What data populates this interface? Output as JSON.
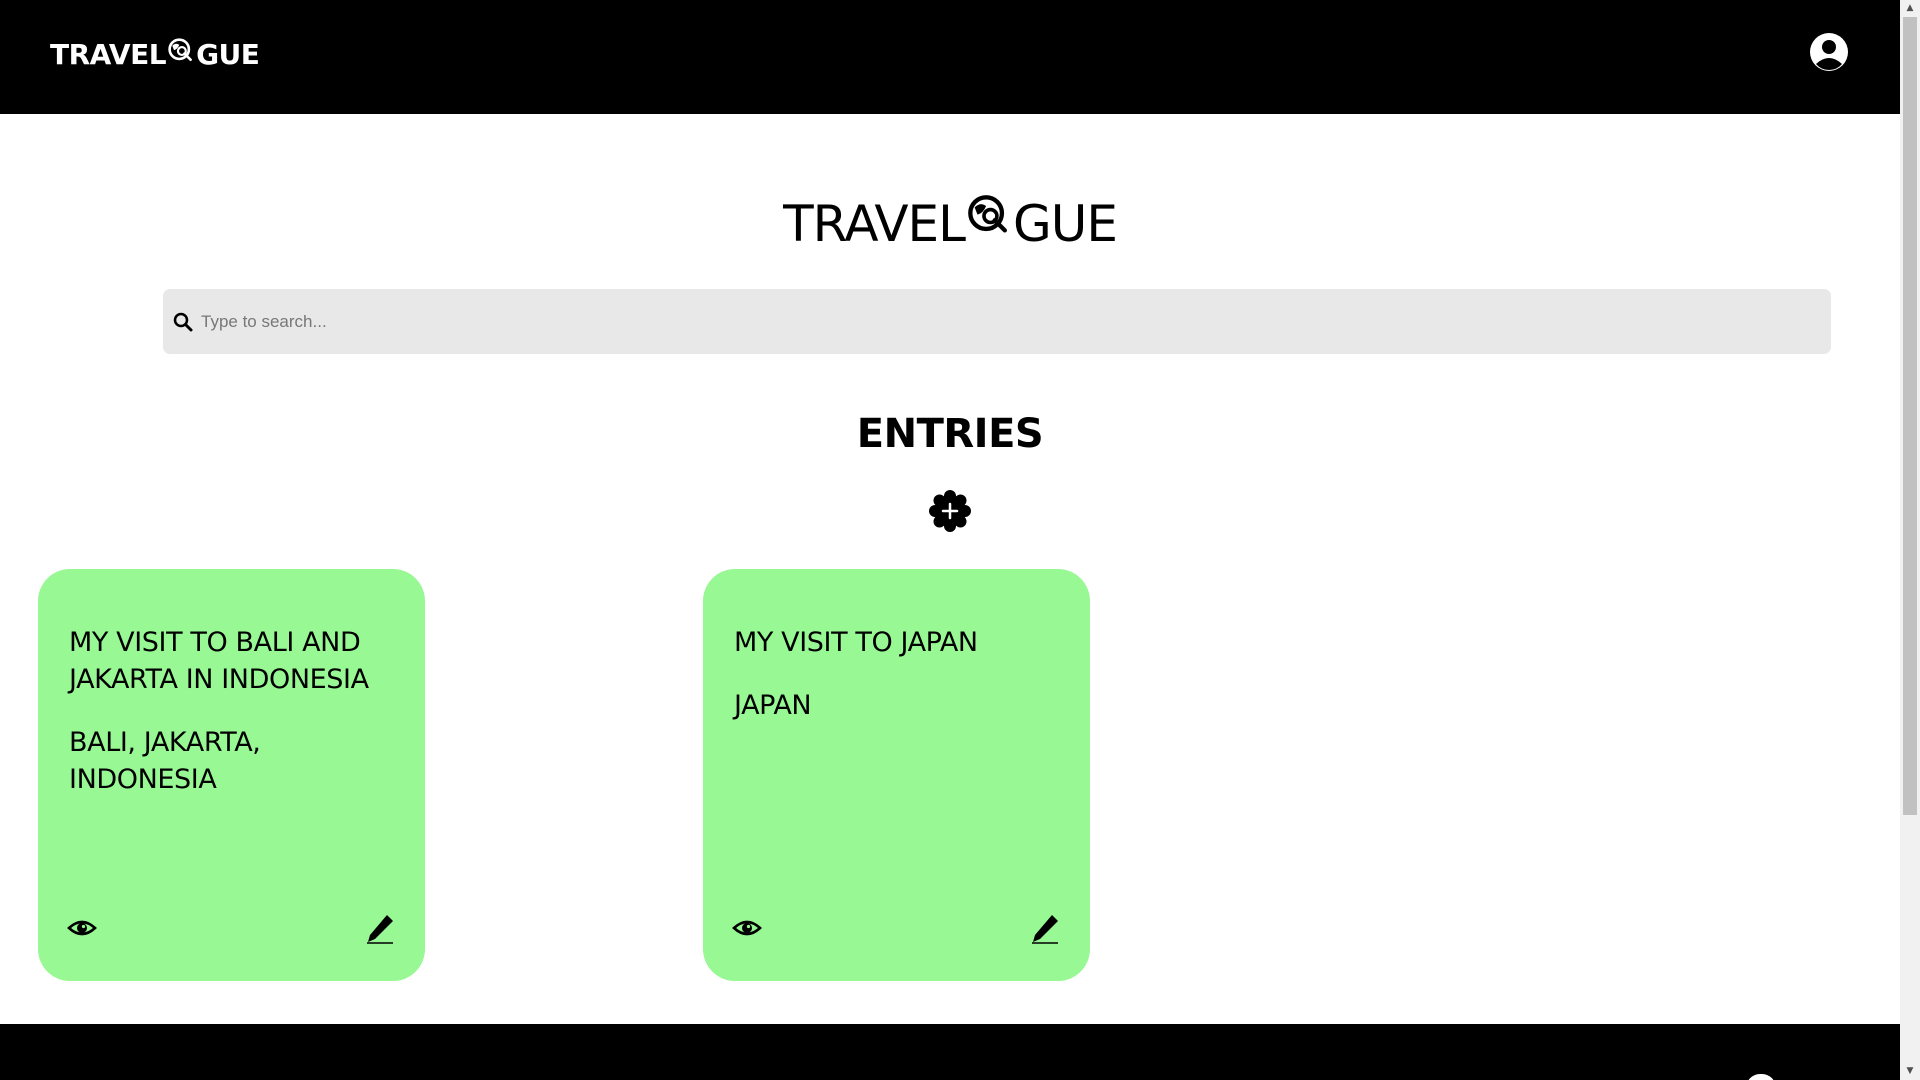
{
  "navbar": {
    "logo_left": "TRAVEL",
    "logo_right": "GUE",
    "profile_icon": "user-circle-icon"
  },
  "hero": {
    "logo_left": "TRAVEL",
    "logo_right": "GUE"
  },
  "search": {
    "placeholder": "Type to search...",
    "value": ""
  },
  "entries": {
    "title": "ENTRIES",
    "add_icon": "plus-badge-icon",
    "items": [
      {
        "title": "MY VISIT TO BALI AND JAKARTA IN INDONESIA",
        "location": "BALI, JAKARTA, INDONESIA",
        "view_icon": "eye-icon",
        "edit_icon": "pencil-icon"
      },
      {
        "title": "MY VISIT TO JAPAN",
        "location": "JAPAN",
        "view_icon": "eye-icon",
        "edit_icon": "pencil-icon"
      }
    ]
  },
  "colors": {
    "nav_bg": "#000000",
    "card_bg": "#98f894",
    "search_bg": "#e8e8e8"
  }
}
